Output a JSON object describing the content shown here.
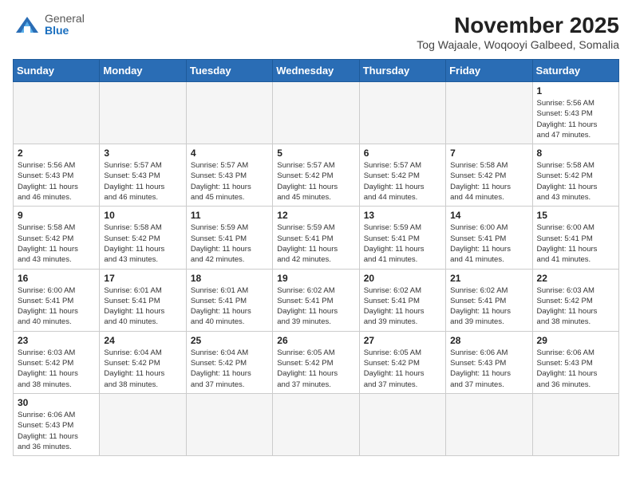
{
  "header": {
    "logo_general": "General",
    "logo_blue": "Blue",
    "month_title": "November 2025",
    "location": "Tog Wajaale, Woqooyi Galbeed, Somalia"
  },
  "weekdays": [
    "Sunday",
    "Monday",
    "Tuesday",
    "Wednesday",
    "Thursday",
    "Friday",
    "Saturday"
  ],
  "weeks": [
    [
      {
        "day": "",
        "info": ""
      },
      {
        "day": "",
        "info": ""
      },
      {
        "day": "",
        "info": ""
      },
      {
        "day": "",
        "info": ""
      },
      {
        "day": "",
        "info": ""
      },
      {
        "day": "",
        "info": ""
      },
      {
        "day": "1",
        "info": "Sunrise: 5:56 AM\nSunset: 5:43 PM\nDaylight: 11 hours\nand 47 minutes."
      }
    ],
    [
      {
        "day": "2",
        "info": "Sunrise: 5:56 AM\nSunset: 5:43 PM\nDaylight: 11 hours\nand 46 minutes."
      },
      {
        "day": "3",
        "info": "Sunrise: 5:57 AM\nSunset: 5:43 PM\nDaylight: 11 hours\nand 46 minutes."
      },
      {
        "day": "4",
        "info": "Sunrise: 5:57 AM\nSunset: 5:43 PM\nDaylight: 11 hours\nand 45 minutes."
      },
      {
        "day": "5",
        "info": "Sunrise: 5:57 AM\nSunset: 5:42 PM\nDaylight: 11 hours\nand 45 minutes."
      },
      {
        "day": "6",
        "info": "Sunrise: 5:57 AM\nSunset: 5:42 PM\nDaylight: 11 hours\nand 44 minutes."
      },
      {
        "day": "7",
        "info": "Sunrise: 5:58 AM\nSunset: 5:42 PM\nDaylight: 11 hours\nand 44 minutes."
      },
      {
        "day": "8",
        "info": "Sunrise: 5:58 AM\nSunset: 5:42 PM\nDaylight: 11 hours\nand 43 minutes."
      }
    ],
    [
      {
        "day": "9",
        "info": "Sunrise: 5:58 AM\nSunset: 5:42 PM\nDaylight: 11 hours\nand 43 minutes."
      },
      {
        "day": "10",
        "info": "Sunrise: 5:58 AM\nSunset: 5:42 PM\nDaylight: 11 hours\nand 43 minutes."
      },
      {
        "day": "11",
        "info": "Sunrise: 5:59 AM\nSunset: 5:41 PM\nDaylight: 11 hours\nand 42 minutes."
      },
      {
        "day": "12",
        "info": "Sunrise: 5:59 AM\nSunset: 5:41 PM\nDaylight: 11 hours\nand 42 minutes."
      },
      {
        "day": "13",
        "info": "Sunrise: 5:59 AM\nSunset: 5:41 PM\nDaylight: 11 hours\nand 41 minutes."
      },
      {
        "day": "14",
        "info": "Sunrise: 6:00 AM\nSunset: 5:41 PM\nDaylight: 11 hours\nand 41 minutes."
      },
      {
        "day": "15",
        "info": "Sunrise: 6:00 AM\nSunset: 5:41 PM\nDaylight: 11 hours\nand 41 minutes."
      }
    ],
    [
      {
        "day": "16",
        "info": "Sunrise: 6:00 AM\nSunset: 5:41 PM\nDaylight: 11 hours\nand 40 minutes."
      },
      {
        "day": "17",
        "info": "Sunrise: 6:01 AM\nSunset: 5:41 PM\nDaylight: 11 hours\nand 40 minutes."
      },
      {
        "day": "18",
        "info": "Sunrise: 6:01 AM\nSunset: 5:41 PM\nDaylight: 11 hours\nand 40 minutes."
      },
      {
        "day": "19",
        "info": "Sunrise: 6:02 AM\nSunset: 5:41 PM\nDaylight: 11 hours\nand 39 minutes."
      },
      {
        "day": "20",
        "info": "Sunrise: 6:02 AM\nSunset: 5:41 PM\nDaylight: 11 hours\nand 39 minutes."
      },
      {
        "day": "21",
        "info": "Sunrise: 6:02 AM\nSunset: 5:41 PM\nDaylight: 11 hours\nand 39 minutes."
      },
      {
        "day": "22",
        "info": "Sunrise: 6:03 AM\nSunset: 5:42 PM\nDaylight: 11 hours\nand 38 minutes."
      }
    ],
    [
      {
        "day": "23",
        "info": "Sunrise: 6:03 AM\nSunset: 5:42 PM\nDaylight: 11 hours\nand 38 minutes."
      },
      {
        "day": "24",
        "info": "Sunrise: 6:04 AM\nSunset: 5:42 PM\nDaylight: 11 hours\nand 38 minutes."
      },
      {
        "day": "25",
        "info": "Sunrise: 6:04 AM\nSunset: 5:42 PM\nDaylight: 11 hours\nand 37 minutes."
      },
      {
        "day": "26",
        "info": "Sunrise: 6:05 AM\nSunset: 5:42 PM\nDaylight: 11 hours\nand 37 minutes."
      },
      {
        "day": "27",
        "info": "Sunrise: 6:05 AM\nSunset: 5:42 PM\nDaylight: 11 hours\nand 37 minutes."
      },
      {
        "day": "28",
        "info": "Sunrise: 6:06 AM\nSunset: 5:43 PM\nDaylight: 11 hours\nand 37 minutes."
      },
      {
        "day": "29",
        "info": "Sunrise: 6:06 AM\nSunset: 5:43 PM\nDaylight: 11 hours\nand 36 minutes."
      }
    ],
    [
      {
        "day": "30",
        "info": "Sunrise: 6:06 AM\nSunset: 5:43 PM\nDaylight: 11 hours\nand 36 minutes."
      },
      {
        "day": "",
        "info": ""
      },
      {
        "day": "",
        "info": ""
      },
      {
        "day": "",
        "info": ""
      },
      {
        "day": "",
        "info": ""
      },
      {
        "day": "",
        "info": ""
      },
      {
        "day": "",
        "info": ""
      }
    ]
  ]
}
